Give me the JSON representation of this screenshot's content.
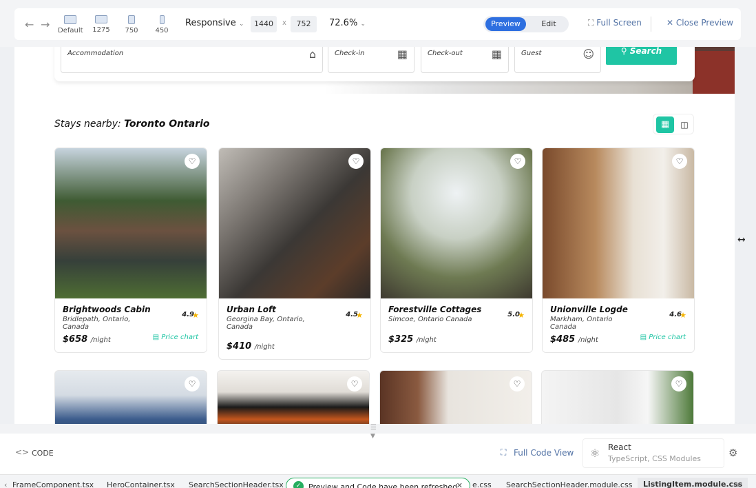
{
  "toolbar": {
    "back_icon": "arrow-left-icon",
    "forward_icon": "arrow-right-icon",
    "devices": [
      {
        "label": "Default",
        "icon": "desktop-icon"
      },
      {
        "label": "1275",
        "icon": "laptop-icon"
      },
      {
        "label": "750",
        "icon": "tablet-icon"
      },
      {
        "label": "450",
        "icon": "phone-icon"
      }
    ],
    "mode": "Responsive",
    "width": "1440",
    "by": "x",
    "height": "752",
    "zoom": "72.6%",
    "preview_label": "Preview",
    "edit_label": "Edit",
    "fullscreen_label": "Full Screen",
    "close_label": "Close Preview"
  },
  "search": {
    "accommodation": "Accommodation",
    "checkin": "Check-in",
    "checkout": "Check-out",
    "guest": "Guest",
    "button": "Search"
  },
  "listing": {
    "prefix": "Stays nearby:",
    "city": "Toronto Ontario",
    "price_chart": "Price chart",
    "per_night": "/night"
  },
  "cards": [
    {
      "title": "Brightwoods Cabin",
      "location": "Bridlepath, Ontario, Canada",
      "rating": "4.9",
      "price": "$658",
      "chart": true,
      "color": "#5f7a4a"
    },
    {
      "title": "Urban Loft",
      "location": "Georgina Bay, Ontario, Canada",
      "rating": "4.5",
      "price": "$410",
      "chart": false,
      "color": "#4a4540"
    },
    {
      "title": "Forestville Cottages",
      "location": "Simcoe, Ontario Canada",
      "rating": "5.0",
      "price": "$325",
      "chart": false,
      "color": "#6e7a52"
    },
    {
      "title": "Unionville Logde",
      "location": "Markham, Ontario Canada",
      "rating": "4.6",
      "price": "$485",
      "chart": true,
      "color": "#9c6b45"
    }
  ],
  "bottom": {
    "code_label": "CODE",
    "full_code_label": "Full Code View",
    "framework": "React",
    "framework_sub": "TypeScript, CSS Modules"
  },
  "tabs": [
    "FrameComponent.tsx",
    "HeroContainer.tsx",
    "SearchSectionHeader.tsx",
    "e.css",
    "SearchSectionHeader.module.css",
    "ListingItem.module.css"
  ],
  "toast": "Preview and Code have been refreshed",
  "colors": {
    "accent": "#1fc5a4",
    "primary": "#2e6fe0",
    "star": "#f5b400"
  }
}
